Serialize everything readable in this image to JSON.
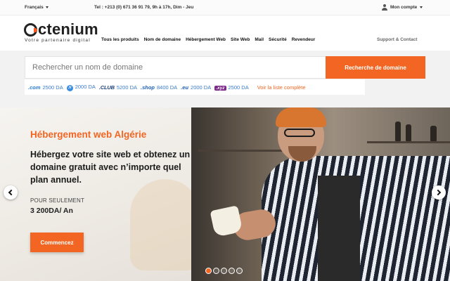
{
  "topbar": {
    "language": "Français",
    "phone": "Tel : +213 (0) 671 36 91 79, 9h à 17h, Dim - Jeu",
    "account": "Mon compte"
  },
  "header": {
    "logo_text": "ctenium",
    "tagline": "Votre partenaire digital",
    "nav": [
      "Tous les produits",
      "Nom de domaine",
      "Hébergement Web",
      "Site Web",
      "Mail",
      "Sécurité",
      "Revendeur"
    ],
    "support": "Support & Contact"
  },
  "search": {
    "placeholder": "Rechercher un nom de domaine",
    "button": "Recherche de domaine"
  },
  "tlds": [
    {
      "name": ".com",
      "price": "2500 DA"
    },
    {
      "name": ".fr",
      "price": "2000 DA"
    },
    {
      "name": ".CLUB",
      "price": "5200 DA"
    },
    {
      "name": ".shop",
      "price": "8400 DA"
    },
    {
      "name": ".eu",
      "price": "2000 DA"
    },
    {
      "name": ".xyz",
      "price": "2500 DA"
    }
  ],
  "tld_link": "Voir la liste complète",
  "hero": {
    "title": "Hébergement web Algérie",
    "subtitle": "Hébergez votre site web et obtenez un domaine gratuit avec n’importe quel plan annuel.",
    "price_label": "POUR SEULEMENT",
    "price": "3 200DA/ An",
    "cta": "Commencez",
    "slides": 5,
    "active_slide": 1
  },
  "colors": {
    "accent": "#f26522",
    "tld_blue": "#2b7bd6",
    "text_dark": "#1b1b1b"
  },
  "icons": [
    "chevron-down-icon",
    "user-icon",
    "chevron-left-icon",
    "chevron-right-icon"
  ]
}
